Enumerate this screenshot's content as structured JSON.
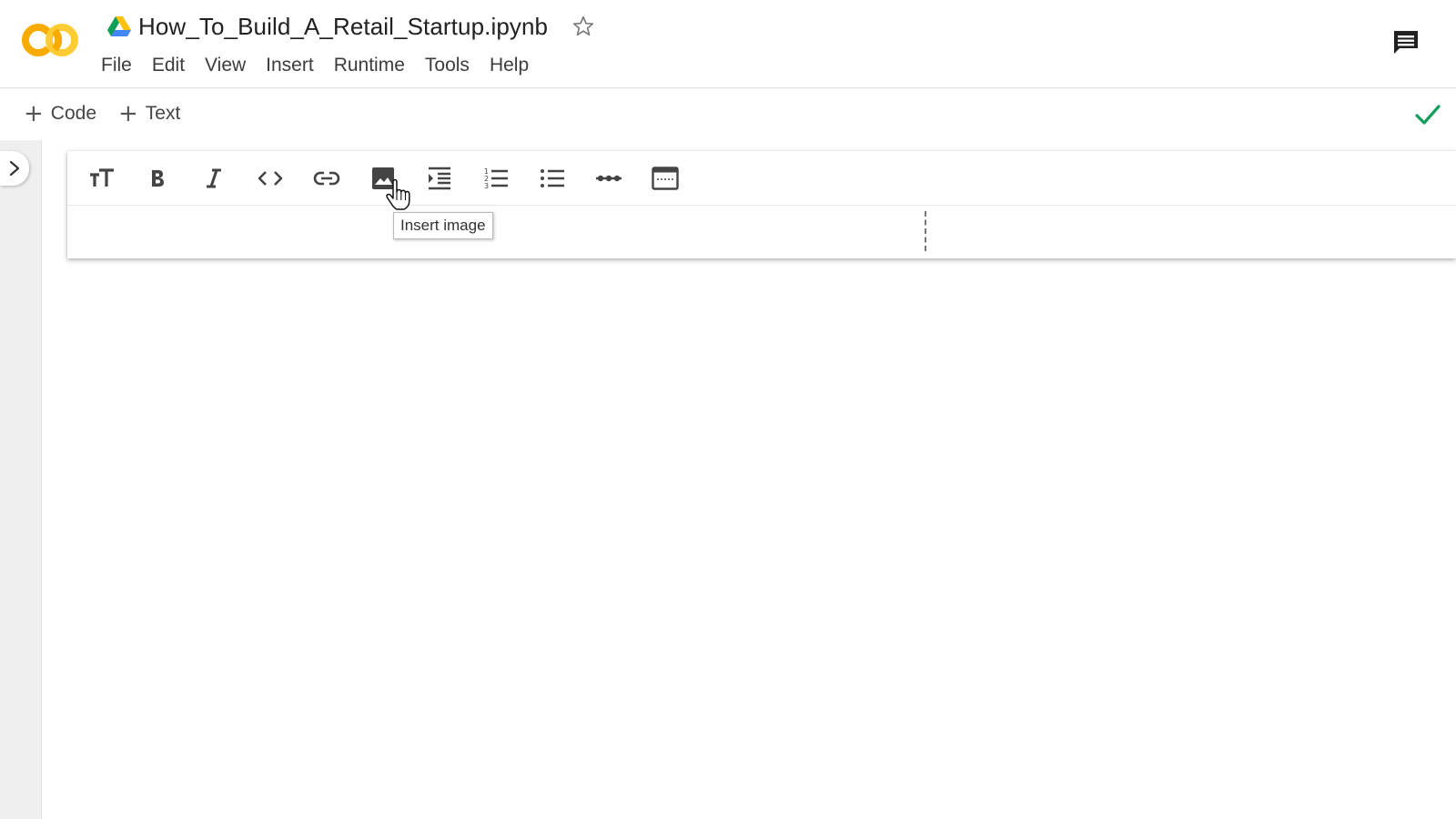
{
  "app": {
    "doc_title": "How_To_Build_A_Retail_Startup.ipynb",
    "icons": [
      "colab-logo",
      "drive-icon",
      "star-icon",
      "comment-icon",
      "check-icon"
    ]
  },
  "menu": {
    "items": [
      {
        "label": "File"
      },
      {
        "label": "Edit"
      },
      {
        "label": "View"
      },
      {
        "label": "Insert"
      },
      {
        "label": "Runtime"
      },
      {
        "label": "Tools"
      },
      {
        "label": "Help"
      }
    ]
  },
  "insert_bar": {
    "code_label": "Code",
    "text_label": "Text",
    "plus_glyph": "+"
  },
  "format_toolbar": {
    "buttons": [
      {
        "name": "heading-icon"
      },
      {
        "name": "bold-icon"
      },
      {
        "name": "italic-icon"
      },
      {
        "name": "code-icon"
      },
      {
        "name": "link-icon"
      },
      {
        "name": "insert-image-icon"
      },
      {
        "name": "indent-icon"
      },
      {
        "name": "numbered-list-icon"
      },
      {
        "name": "bulleted-list-icon"
      },
      {
        "name": "horizontal-rule-icon"
      },
      {
        "name": "preview-toggle-icon"
      }
    ],
    "tooltip": "Insert image"
  },
  "colors": {
    "logo_orange": "#F9AB00",
    "logo_yellow": "#FFD54F",
    "check_green": "#0F9D58",
    "icon_gray": "#555555"
  }
}
